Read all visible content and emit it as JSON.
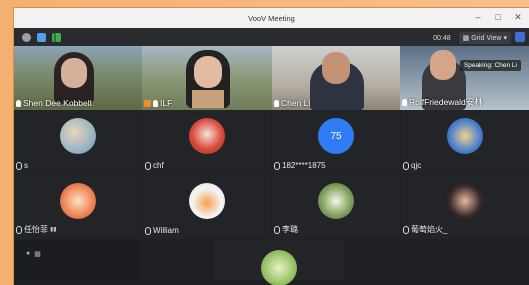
{
  "window": {
    "title": "VooV Meeting"
  },
  "toolbar": {
    "time": "00:48",
    "view_label": "Grid View"
  },
  "speaking": "Speaking: Chen Li",
  "video_participants": [
    {
      "name": "Shen Dee Kobbelt"
    },
    {
      "name": "ILF"
    },
    {
      "name": "Chen Li"
    },
    {
      "name": "RolfFriedewald安林"
    }
  ],
  "grid_participants": [
    {
      "name": "s"
    },
    {
      "name": "chf"
    },
    {
      "name": "182****1875",
      "avatar_text": "75"
    },
    {
      "name": "qjc"
    },
    {
      "name": "任怡菲"
    },
    {
      "name": "William"
    },
    {
      "name": "李璐"
    },
    {
      "name": "葡萄焰火_"
    }
  ],
  "colors": {
    "avatar_blue": "#2f7cf6"
  }
}
